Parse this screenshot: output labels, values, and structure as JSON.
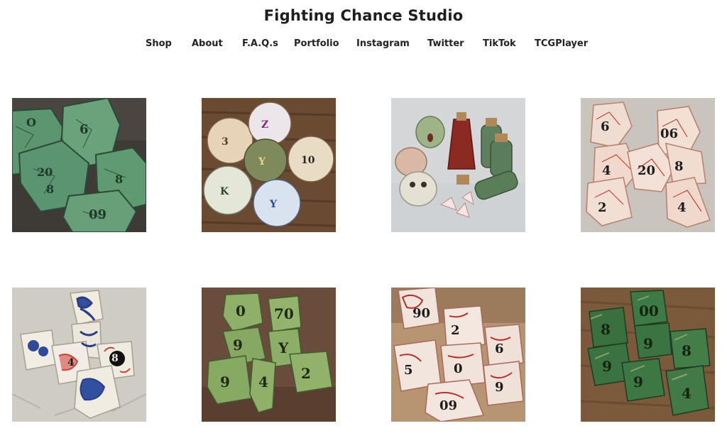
{
  "site": {
    "title": "Fighting Chance Studio"
  },
  "nav": {
    "items": [
      {
        "label": "Shop"
      },
      {
        "label": "About"
      },
      {
        "label": "F.A.Q.s"
      },
      {
        "label": "Portfolio"
      },
      {
        "label": "Instagram"
      },
      {
        "label": "Twitter"
      },
      {
        "label": "TikTok"
      },
      {
        "label": "TCGPlayer"
      }
    ]
  },
  "gallery": {
    "tiles": [
      {
        "subject": "green crackle ceramic dice set",
        "colors": {
          "bg": "#3e3a36",
          "die": "#5c9670",
          "ink": "#1e3a2a"
        }
      },
      {
        "subject": "assorted pastel d20 dice on wood",
        "colors": {
          "bg": "#6b4a32",
          "die": "#e8dcc4",
          "ink": "#3a2a22"
        }
      },
      {
        "subject": "ceramic doll heads and potion bottles",
        "colors": {
          "bg": "#d4d6d8",
          "die": "#5f7f5e",
          "ink": "#8a2a22"
        }
      },
      {
        "subject": "white and red crackle dice set",
        "colors": {
          "bg": "#c9c4bd",
          "die": "#f0ddd2",
          "ink": "#c9442e"
        }
      },
      {
        "subject": "blue and red floral porcelain dice",
        "colors": {
          "bg": "#cfccc6",
          "die": "#f1ebe0",
          "ink": "#283f86"
        }
      },
      {
        "subject": "light green ceramic dice set",
        "colors": {
          "bg": "#6a4c3c",
          "die": "#8fb069",
          "ink": "#1f2a14"
        }
      },
      {
        "subject": "red toile porcelain dice set",
        "colors": {
          "bg": "#b79472",
          "die": "#f1e4dc",
          "ink": "#b3322b"
        }
      },
      {
        "subject": "dark green glazed dice on wood",
        "colors": {
          "bg": "#7b5a3c",
          "die": "#3e7a45",
          "ink": "#1a2b14"
        }
      }
    ]
  }
}
